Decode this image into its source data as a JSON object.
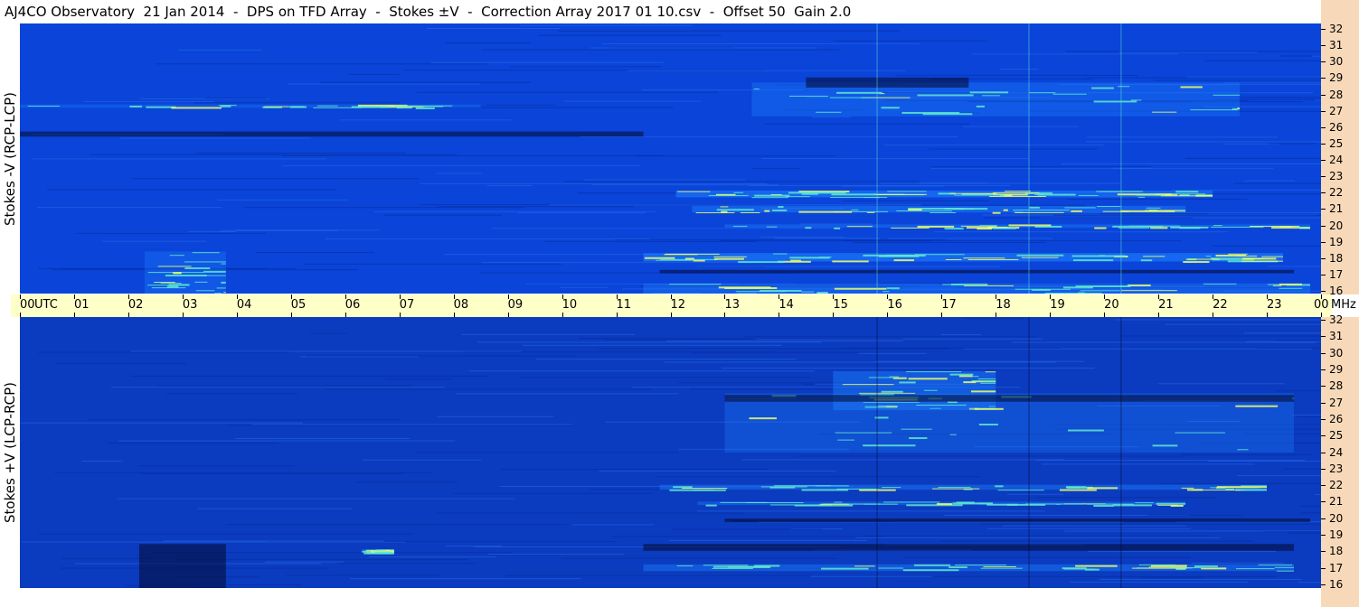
{
  "title": "AJ4CO Observatory  21 Jan 2014  -  DPS on TFD Array  -  Stokes ±V  -  Correction Array 2017 01 10.csv  -  Offset 50  Gain 2.0",
  "chart_data": {
    "type": "heatmap",
    "title": "AJ4CO Observatory  21 Jan 2014  -  DPS on TFD Array  -  Stokes ±V  -  Correction Array 2017 01 10.csv  -  Offset 50  Gain 2.0",
    "xlabel": "UTC",
    "ylabel_unit": "MHz",
    "x_ticks": [
      "00",
      "01",
      "02",
      "03",
      "04",
      "05",
      "06",
      "07",
      "08",
      "09",
      "10",
      "11",
      "12",
      "13",
      "14",
      "15",
      "16",
      "17",
      "18",
      "19",
      "20",
      "21",
      "22",
      "23",
      "00"
    ],
    "xlim": [
      0,
      24
    ],
    "ylim": [
      16,
      32
    ],
    "y_ticks": [
      "16",
      "17",
      "18",
      "19",
      "20",
      "21",
      "22",
      "23",
      "24",
      "25",
      "26",
      "27",
      "28",
      "29",
      "30",
      "31",
      "32"
    ],
    "colors": {
      "background": "#0a3fc8",
      "low": "#050a30",
      "mid": "#1e7fff",
      "high": "#5fe8d0",
      "peak": "#f0ff6a",
      "axis_strip": "#f7d9b9",
      "time_strip": "#ffffc8"
    },
    "panels": [
      {
        "ylabel": "Stokes -V (RCP-LCP)",
        "base_color": "#0a44d8",
        "bands": [
          {
            "t0": 11.5,
            "t1": 23.3,
            "f0": 17.9,
            "f1": 18.4,
            "intensity": 0.9
          },
          {
            "t0": 12.1,
            "t1": 22.0,
            "f0": 21.7,
            "f1": 22.1,
            "intensity": 0.85
          },
          {
            "t0": 12.4,
            "t1": 21.5,
            "f0": 20.8,
            "f1": 21.2,
            "intensity": 0.6
          },
          {
            "t0": 13.0,
            "t1": 23.8,
            "f0": 19.9,
            "f1": 20.1,
            "intensity": 0.5
          },
          {
            "t0": 13.5,
            "t1": 22.5,
            "f0": 26.5,
            "f1": 28.5,
            "intensity": 0.4
          },
          {
            "t0": 11.5,
            "t1": 23.8,
            "f0": 16.0,
            "f1": 16.6,
            "intensity": 0.5
          },
          {
            "t0": 2.3,
            "t1": 3.8,
            "f0": 16.0,
            "f1": 18.5,
            "intensity": 0.35
          },
          {
            "t0": 0.0,
            "t1": 8.5,
            "f0": 27.0,
            "f1": 27.2,
            "intensity": 0.3
          }
        ],
        "dark_bands": [
          {
            "t0": 14.5,
            "t1": 17.5,
            "f0": 28.2,
            "f1": 28.8
          },
          {
            "t0": 11.8,
            "t1": 23.5,
            "f0": 17.2,
            "f1": 17.4
          },
          {
            "t0": 0.0,
            "t1": 11.5,
            "f0": 25.3,
            "f1": 25.6
          }
        ]
      },
      {
        "ylabel": "Stokes +V (LCP-RCP)",
        "base_color": "#0b3bbf",
        "bands": [
          {
            "t0": 11.8,
            "t1": 23.0,
            "f0": 21.8,
            "f1": 22.1,
            "intensity": 0.55
          },
          {
            "t0": 12.5,
            "t1": 21.5,
            "f0": 20.9,
            "f1": 21.1,
            "intensity": 0.45
          },
          {
            "t0": 11.5,
            "t1": 23.5,
            "f0": 17.0,
            "f1": 17.4,
            "intensity": 0.55
          },
          {
            "t0": 15.0,
            "t1": 18.0,
            "f0": 26.5,
            "f1": 28.8,
            "intensity": 0.6
          },
          {
            "t0": 13.0,
            "t1": 23.5,
            "f0": 24.0,
            "f1": 27.5,
            "intensity": 0.25
          },
          {
            "t0": 6.3,
            "t1": 6.9,
            "f0": 18.1,
            "f1": 18.3,
            "intensity": 0.5
          }
        ],
        "dark_bands": [
          {
            "t0": 13.0,
            "t1": 23.5,
            "f0": 27.0,
            "f1": 27.4
          },
          {
            "t0": 13.0,
            "t1": 23.8,
            "f0": 19.9,
            "f1": 20.1
          },
          {
            "t0": 2.2,
            "t1": 3.8,
            "f0": 16.0,
            "f1": 18.6
          },
          {
            "t0": 11.5,
            "t1": 23.5,
            "f0": 18.2,
            "f1": 18.6
          }
        ]
      }
    ]
  }
}
